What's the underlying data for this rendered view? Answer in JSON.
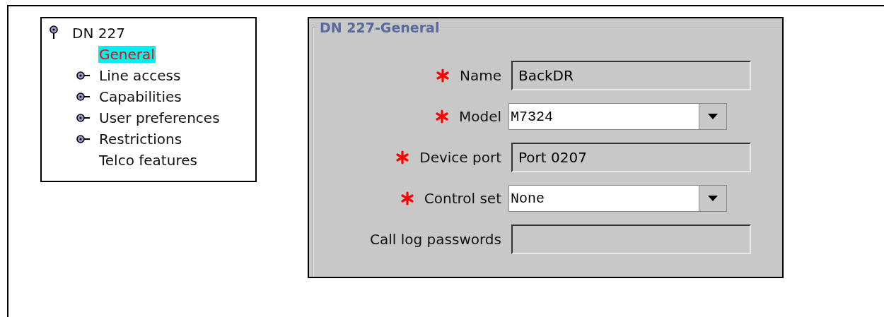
{
  "tree": {
    "label": "DN 227",
    "children": [
      {
        "label": "General",
        "selected": true,
        "expandable": false
      },
      {
        "label": "Line access",
        "selected": false,
        "expandable": true
      },
      {
        "label": "Capabilities",
        "selected": false,
        "expandable": true
      },
      {
        "label": "User preferences",
        "selected": false,
        "expandable": true
      },
      {
        "label": "Restrictions",
        "selected": false,
        "expandable": true
      },
      {
        "label": "Telco features",
        "selected": false,
        "expandable": false
      }
    ]
  },
  "panel": {
    "title": "DN 227-General",
    "fields": [
      {
        "label": "Name",
        "required": true,
        "kind": "text",
        "value": "BackDR"
      },
      {
        "label": "Model",
        "required": true,
        "kind": "combo",
        "value": "M7324"
      },
      {
        "label": "Device port",
        "required": true,
        "kind": "text",
        "value": "Port 0207"
      },
      {
        "label": "Control set",
        "required": true,
        "kind": "combo",
        "value": "None"
      },
      {
        "label": "Call log passwords",
        "required": false,
        "kind": "text"
      }
    ]
  }
}
